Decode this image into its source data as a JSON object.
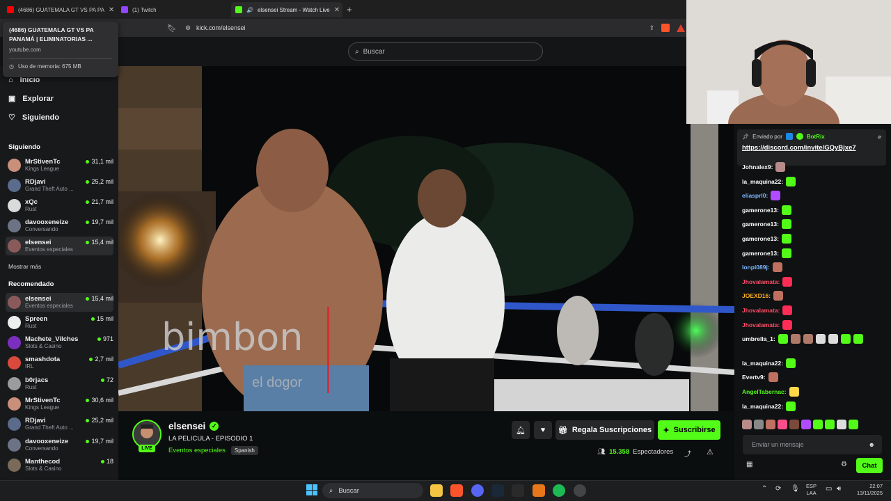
{
  "browser": {
    "tabs": [
      {
        "label": "(4686) GUATEMALA GT VS PA PA",
        "favicon_color": "#ff0000"
      },
      {
        "label": "(1) Twitch",
        "favicon_color": "#9146ff"
      },
      {
        "label": "elsensei Stream - Watch Live",
        "favicon_color": "#53fc18"
      }
    ],
    "url": "kick.com/elsensei",
    "tooltip": {
      "title": "(4686) GUATEMALA GT VS PA PANAMÁ | ELIMINATORIAS ...",
      "host": "youtube.com",
      "memory": "Uso de memoria: 675 MB"
    }
  },
  "header": {
    "search_placeholder": "Buscar"
  },
  "sidebar": {
    "nav": [
      {
        "label": "Inicio",
        "icon": "home-icon"
      },
      {
        "label": "Explorar",
        "icon": "compass-icon"
      },
      {
        "label": "Siguiendo",
        "icon": "heart-icon"
      }
    ],
    "following_title": "Siguiendo",
    "following": [
      {
        "name": "MrStivenTc",
        "category": "Kings League",
        "viewers": "31,1 mil",
        "color": "#c98f7a"
      },
      {
        "name": "RDjavi",
        "category": "Grand Theft Auto ...",
        "viewers": "25,2 mil",
        "color": "#5a6b8c"
      },
      {
        "name": "xQc",
        "category": "Rust",
        "viewers": "21,7 mil",
        "color": "#dadada"
      },
      {
        "name": "davooxeneize",
        "category": "Conversando",
        "viewers": "19,7 mil",
        "color": "#6c7384"
      },
      {
        "name": "elsensei",
        "category": "Eventos especiales",
        "viewers": "15,4 mil",
        "color": "#8a5a5a"
      }
    ],
    "show_more": "Mostrar más",
    "recommended_title": "Recomendado",
    "recommended": [
      {
        "name": "elsensei",
        "category": "Eventos especiales",
        "viewers": "15,4 mil",
        "color": "#8a5a5a"
      },
      {
        "name": "Spreen",
        "category": "Rust",
        "viewers": "15 mil",
        "color": "#eeeeee"
      },
      {
        "name": "Machete_Vilches",
        "category": "Slots & Casino",
        "viewers": "971",
        "color": "#7b2fbf"
      },
      {
        "name": "smashdota",
        "category": "IRL",
        "viewers": "2,7 mil",
        "color": "#d94a3c"
      },
      {
        "name": "b0rjacs",
        "category": "Rust",
        "viewers": "72",
        "color": "#9c9c9c"
      },
      {
        "name": "MrStivenTc",
        "category": "Kings League",
        "viewers": "30,6 mil",
        "color": "#c98f7a"
      },
      {
        "name": "RDjavi",
        "category": "Grand Theft Auto ...",
        "viewers": "25,2 mil",
        "color": "#5a6b8c"
      },
      {
        "name": "davooxeneize",
        "category": "Conversando",
        "viewers": "19,7 mil",
        "color": "#6c7384"
      },
      {
        "name": "Manthecod",
        "category": "Slots & Casino",
        "viewers": "18",
        "color": "#7a6a5a"
      }
    ]
  },
  "video": {
    "overlay_text": "bimbon",
    "overlay_sub": "el dogor"
  },
  "stream": {
    "channel": "elsensei",
    "live_label": "LIVE",
    "title": "LA PELICULA - EPISODIO 1",
    "category": "Eventos especiales",
    "language": "Spanish",
    "gift_label": "Regala Suscripciones",
    "subscribe_label": "Suscribirse",
    "viewers_count": "15.358",
    "viewers_label": "Espectadores"
  },
  "chat": {
    "pinned_by_prefix": "Enviado por",
    "pinned_by": "BotRix",
    "pinned_link": "https://discord.com/invite/GQyBjxe7",
    "messages": [
      {
        "user": "Johnalex9:",
        "color": "#ffffff",
        "emotes": [
          "#b88a8a"
        ]
      },
      {
        "user": "la_maquina22:",
        "color": "#ffffff",
        "emotes": [
          "#53fc18"
        ]
      },
      {
        "user": "eliasprl0:",
        "color": "#7bb8ff",
        "emotes": [
          "#b04cff"
        ]
      },
      {
        "user": "gamerone13:",
        "color": "#ffffff",
        "emotes": [
          "#53fc18"
        ]
      },
      {
        "user": "gamerone13:",
        "color": "#ffffff",
        "emotes": [
          "#53fc18"
        ]
      },
      {
        "user": "gamerone13:",
        "color": "#ffffff",
        "emotes": [
          "#53fc18"
        ]
      },
      {
        "user": "gamerone13:",
        "color": "#ffffff",
        "emotes": [
          "#53fc18"
        ]
      },
      {
        "user": "lonpi089j:",
        "color": "#7bb8ff",
        "emotes": [
          "#c07060"
        ]
      },
      {
        "user": "Jhovalamata:",
        "color": "#ff4d6a",
        "emotes": [
          "#ff2d55"
        ]
      },
      {
        "user": "JOEXD16:",
        "color": "#ffb020",
        "emotes": [
          "#c07060"
        ]
      },
      {
        "user": "Jhovalamata:",
        "color": "#ff4d6a",
        "emotes": [
          "#ff2d55"
        ]
      },
      {
        "user": "Jhovalamata:",
        "color": "#ff4d6a",
        "emotes": [
          "#ff2d55"
        ]
      },
      {
        "user": "umbrella_1:",
        "color": "#ffffff",
        "emotes": [
          "#53fc18",
          "#b07a6a",
          "#b07a6a",
          "#dddddd",
          "#dddddd",
          "#53fc18",
          "#53fc18"
        ]
      },
      {
        "user": "la_maquina22:",
        "color": "#ffffff",
        "emotes": [
          "#53fc18"
        ]
      },
      {
        "user": "Evertv9:",
        "color": "#ffffff",
        "emotes": [
          "#c07060"
        ]
      },
      {
        "user": "AngelTabernac:",
        "color": "#53fc18",
        "emotes": [
          "#ffd84a"
        ]
      },
      {
        "user": "la_maquina22:",
        "color": "#ffffff",
        "emotes": [
          "#53fc18"
        ]
      }
    ],
    "input_placeholder": "Enviar un mensaje",
    "send_label": "Chat"
  },
  "taskbar": {
    "search_label": "Buscar",
    "lang_top": "ESP",
    "lang_bottom": "LAA",
    "time": "22:07",
    "date": "13/11/2025"
  }
}
